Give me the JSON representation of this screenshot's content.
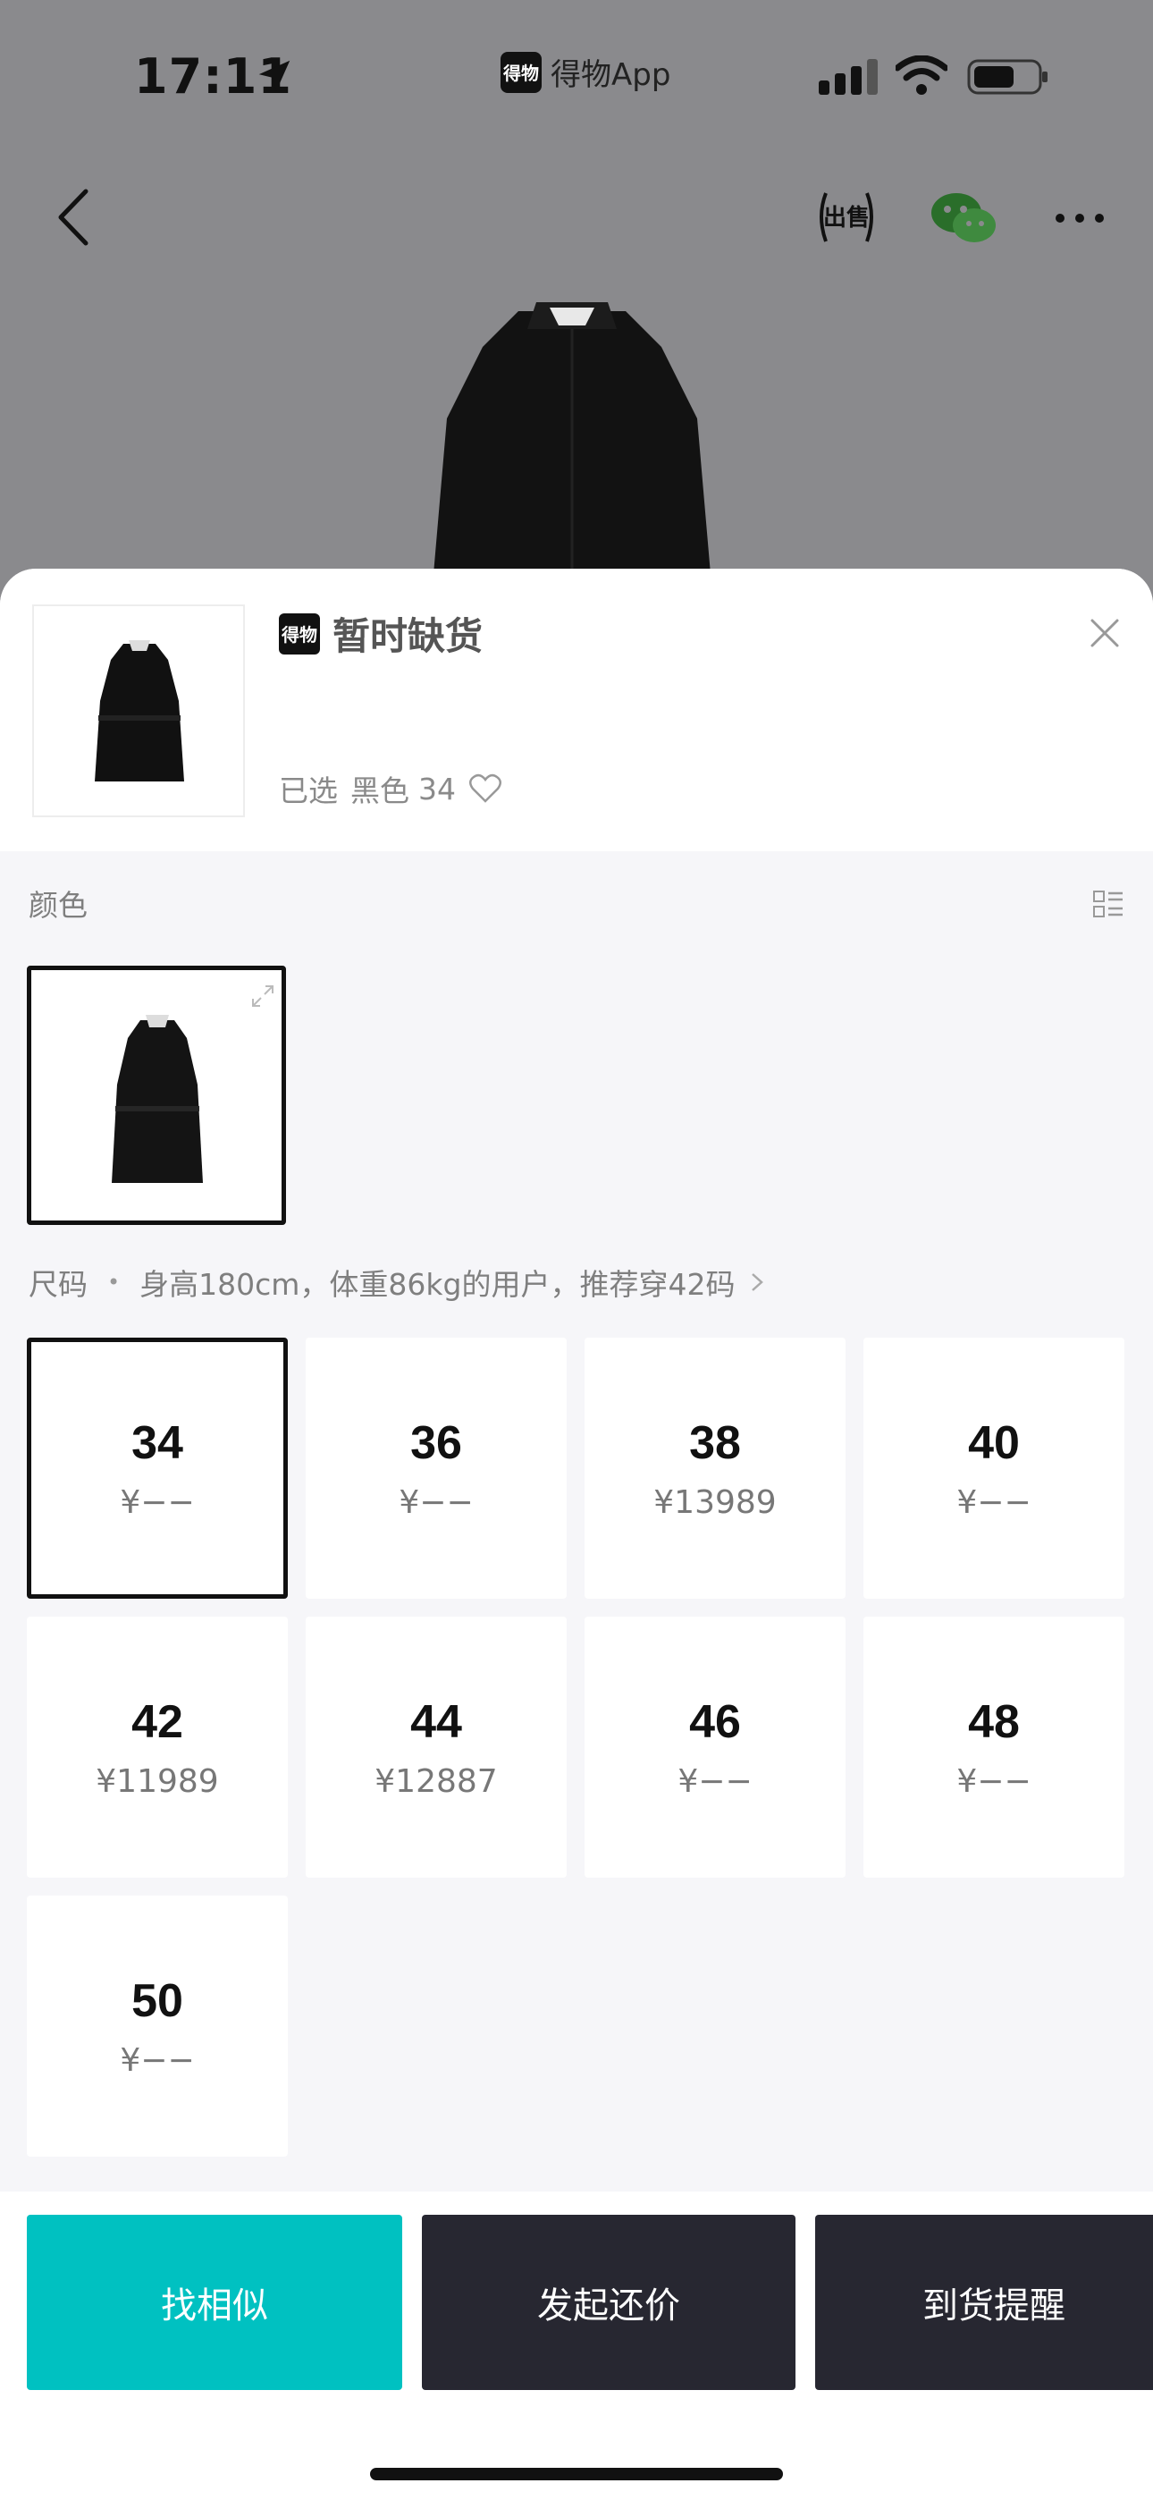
{
  "status_bar": {
    "time": "17:11",
    "app_name": "得物App",
    "app_logo_text": "得物"
  },
  "header": {
    "sell_icon_text": "出售"
  },
  "sheet": {
    "logo_text": "得物",
    "stock_status": "暂时缺货",
    "selected_prefix": "已选",
    "selected_color": "黑色",
    "selected_size": "34",
    "color_label": "颜色",
    "size_label": "尺码",
    "size_recommendation": "身高180cm，体重86kg的用户，推荐穿42码",
    "sizes": [
      {
        "size": "34",
        "price": "¥−−",
        "selected": true
      },
      {
        "size": "36",
        "price": "¥−−",
        "selected": false
      },
      {
        "size": "38",
        "price": "¥13989",
        "selected": false
      },
      {
        "size": "40",
        "price": "¥−−",
        "selected": false
      },
      {
        "size": "42",
        "price": "¥11989",
        "selected": false
      },
      {
        "size": "44",
        "price": "¥12887",
        "selected": false
      },
      {
        "size": "46",
        "price": "¥−−",
        "selected": false
      },
      {
        "size": "48",
        "price": "¥−−",
        "selected": false
      },
      {
        "size": "50",
        "price": "¥−−",
        "selected": false
      }
    ]
  },
  "actions": {
    "find_similar": "找相似",
    "make_offer": "发起还价",
    "restock_alert": "到货提醒"
  },
  "colors": {
    "accent_teal": "#00c1c1",
    "dark_button": "#272731",
    "overlay_gray": "#8a8a8d"
  }
}
